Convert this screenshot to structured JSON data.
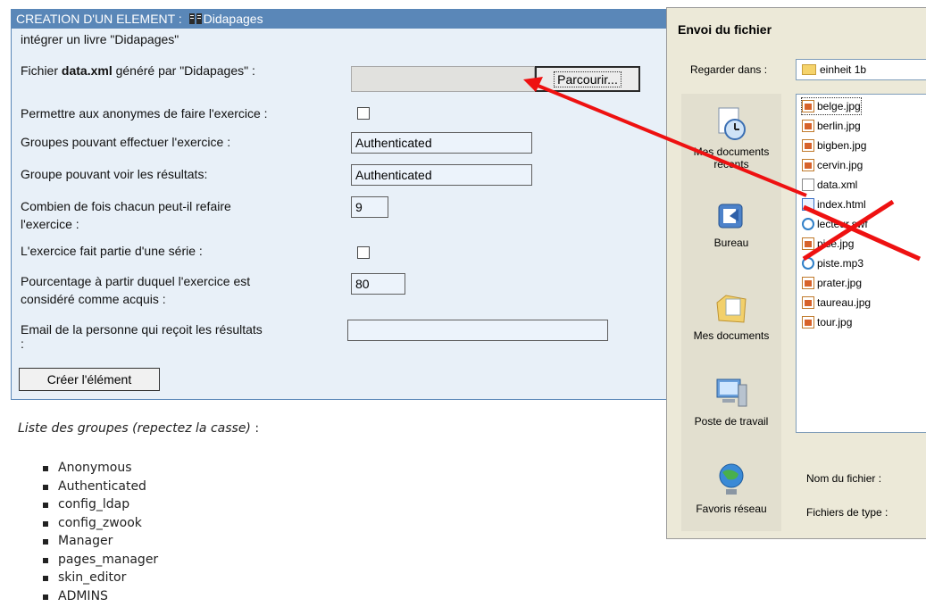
{
  "panel": {
    "title_prefix": "CREATION D'UN ELEMENT :",
    "title_name": "Didapages",
    "subtitle": "intégrer un livre \"Didapages\"",
    "file_label_pre": "Fichier ",
    "file_label_bold": "data.xml",
    "file_label_post": " généré par \"Didapages\" :",
    "browse_button": "Parcourir...",
    "anon_label": "Permettre aux anonymes de faire l'exercice :",
    "groups_do_label": "Groupes pouvant effectuer l'exercice :",
    "groups_do_value": "Authenticated",
    "group_see_label": "Groupe pouvant voir les résultats:",
    "group_see_value": "Authenticated",
    "redo_label_1": "Combien de fois chacun peut-il refaire",
    "redo_label_2": "l'exercice :",
    "redo_value": "9",
    "series_label": "L'exercice fait partie d'une série :",
    "percent_label_1": "Pourcentage à partir duquel l'exercice est",
    "percent_label_2": "considéré comme acquis :",
    "percent_value": "80",
    "email_label_1": "Email de la personne qui reçoit les résultats",
    "email_label_2": ":",
    "email_value": "",
    "create_button": "Créer l'élément"
  },
  "groups": {
    "title_main": "Liste des groupes (repectez la casse)",
    "title_suffix": " :",
    "items": [
      "Anonymous",
      "Authenticated",
      "config_ldap",
      "config_zwook",
      "Manager",
      "pages_manager",
      "skin_editor",
      "ADMINS"
    ]
  },
  "dialog": {
    "title": "Envoi du fichier",
    "look_in_label": "Regarder dans :",
    "look_in_value": "einheit 1b",
    "places": [
      {
        "label_1": "Mes documents",
        "label_2": "récents"
      },
      {
        "label_1": "Bureau",
        "label_2": ""
      },
      {
        "label_1": "Mes documents",
        "label_2": ""
      },
      {
        "label_1": "Poste de travail",
        "label_2": ""
      },
      {
        "label_1": "Favoris réseau",
        "label_2": ""
      }
    ],
    "files": [
      "belge.jpg",
      "berlin.jpg",
      "bigben.jpg",
      "cervin.jpg",
      "data.xml",
      "index.html",
      "lecteur.swf",
      "pise.jpg",
      "piste.mp3",
      "prater.jpg",
      "taureau.jpg",
      "tour.jpg"
    ],
    "filename_label": "Nom du fichier :",
    "filetype_label": "Fichiers de type :"
  },
  "colors": {
    "header_blue": "#5a87b8",
    "panel_bg": "#e8f0f8",
    "arrow_red": "#ee1111"
  }
}
